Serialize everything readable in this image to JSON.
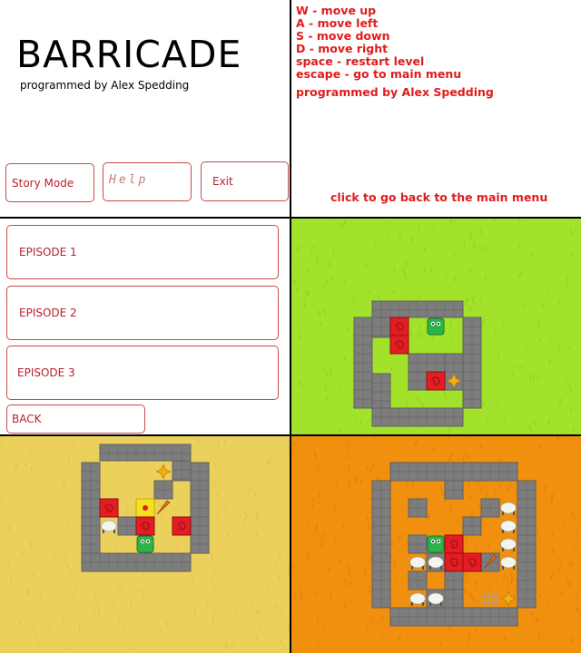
{
  "title_screen": {
    "title": "BARRICADE",
    "byline": "programmed by Alex Spedding",
    "buttons": {
      "story": "Story Mode",
      "help": "Help",
      "exit": "Exit"
    }
  },
  "help_screen": {
    "controls": [
      "W - move up",
      "A - move left",
      "S - move down",
      "D - move right",
      "space - restart level",
      "escape - go to main menu"
    ],
    "credit": "programmed by Alex Spedding",
    "back_link": "click to go back to the main menu"
  },
  "episode_screen": {
    "episodes": [
      "EPISODE 1",
      "EPISODE 2",
      "EPISODE 3"
    ],
    "back": "BACK"
  },
  "colors": {
    "accent_red": "#e01c1c",
    "grass": "#a3e22a",
    "sand": "#ecd05c",
    "lava": "#f0900e",
    "wall": "#7d7d7d",
    "crate": "#e51d23",
    "player": "#2eb34a"
  },
  "levels": [
    {
      "name": "grass-level",
      "icons": [
        "crate-icon",
        "player-icon",
        "star-goal-icon"
      ]
    },
    {
      "name": "sand-level",
      "icons": [
        "crate-icon",
        "player-icon",
        "star-goal-icon",
        "sheep-icon",
        "carrot-icon"
      ]
    },
    {
      "name": "lava-level",
      "icons": [
        "crate-icon",
        "player-icon",
        "star-goal-icon",
        "sheep-icon",
        "carrot-icon",
        "fence-icon"
      ]
    }
  ]
}
